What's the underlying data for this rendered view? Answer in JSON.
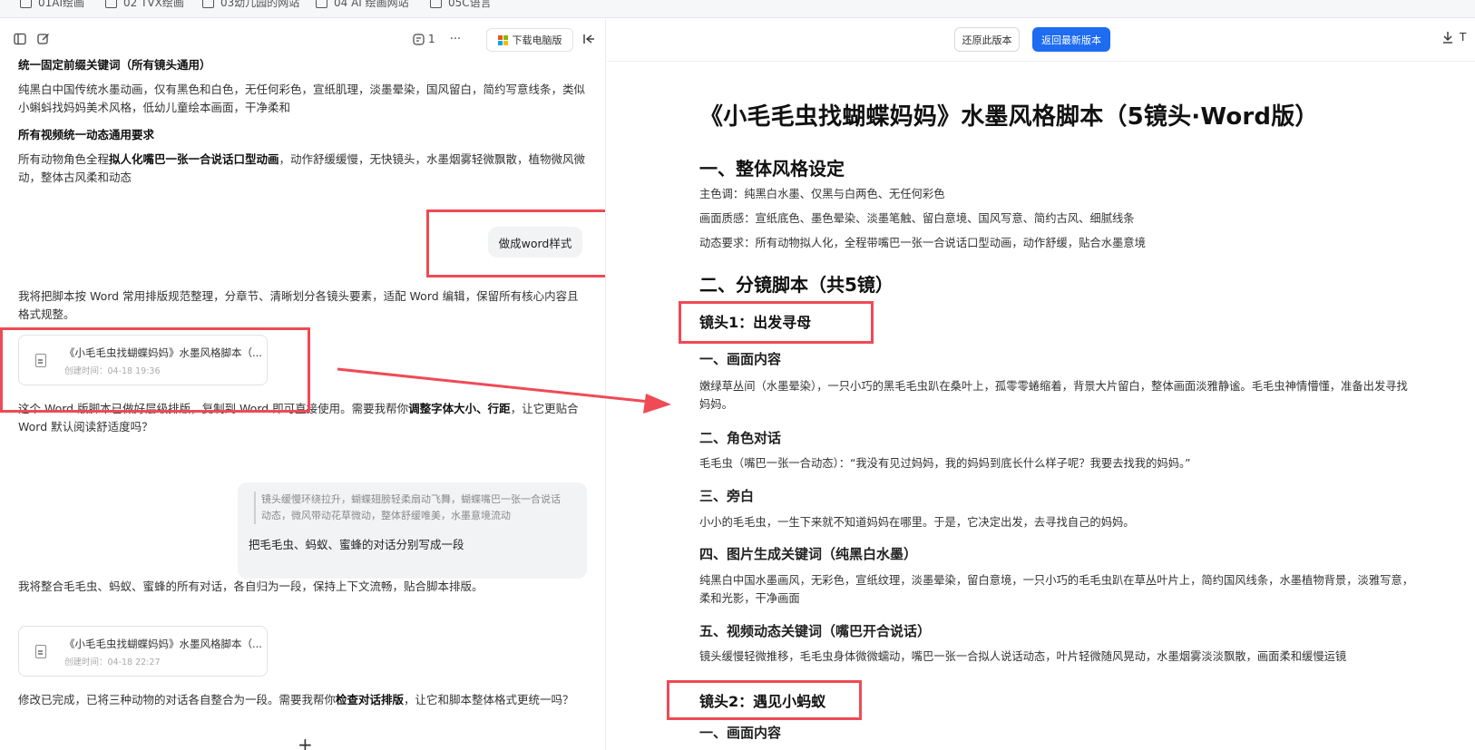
{
  "bookmarks": [
    "01AI绘画",
    "02 TVX绘画",
    "03幼儿园的网站",
    "04 AI 绘画网站",
    "05C语言"
  ],
  "left": {
    "toolbar": {
      "panel_icon": "sidebar-toggle-icon",
      "edit_icon": "edit-icon",
      "count": "1",
      "more": "···",
      "download_label": "下载电脑版",
      "collapse_icon": "collapse-icon"
    },
    "heading1": "统一固定前缀关键词（所有镜头通用）",
    "para1": "纯黑白中国传统水墨动画，仅有黑色和白色，无任何彩色，宣纸肌理，淡墨晕染，国风留白，简约写意线条，类似小蝌蚪找妈妈美术风格，低幼儿童绘本画面，干净柔和",
    "heading2": "所有视频统一动态通用要求",
    "para2_a": "所有动物角色全程",
    "para2_bold": "拟人化嘴巴一张一合说话口型动画",
    "para2_b": "，动作舒缓缓慢，无快镜头，水墨烟雾轻微飘散，植物微风微动，整体古风柔和动态",
    "user_msg1": "做成word样式",
    "para3": "我将把脚本按 Word 常用排版规范整理，分章节、清晰划分各镜头要素，适配 Word 编辑，保留所有核心内容且格式规整。",
    "card1": {
      "title": "《小毛毛虫找蝴蝶妈妈》水墨风格脚本（...",
      "date": "创建时间：04-18 19:36"
    },
    "para4_a": "这个 Word 版脚本已做好层级排版，复制到 Word 即可直接使用。需要我帮你",
    "para4_bold": "调整字体大小、行距",
    "para4_b": "，让它更贴合 Word 默认阅读舒适度吗？",
    "quote_text": "镜头缓慢环绕拉升，蝴蝶翅膀轻柔扇动飞舞，蝴蝶嘴巴一张一合说话动态，微风带动花草微动，整体舒缓唯美，水墨意境流动",
    "user_msg2": "把毛毛虫、蚂蚁、蜜蜂的对话分别写成一段",
    "para5": "我将整合毛毛虫、蚂蚁、蜜蜂的所有对话，各自归为一段，保持上下文流畅，贴合脚本排版。",
    "card2": {
      "title": "《小毛毛虫找蝴蝶妈妈》水墨风格脚本（...",
      "date": "创建时间：04-18 22:27"
    },
    "para6_a": "修改已完成，已将三种动物的对话各自整合为一段。需要我帮你",
    "para6_bold": "检查对话排版",
    "para6_b": "，让它和脚本整体格式更统一吗？",
    "plus": "+"
  },
  "right": {
    "restore_label": "还原此版本",
    "latest_label": "返回最新版本",
    "download_t": "T",
    "doc": {
      "title": "《小毛毛虫找蝴蝶妈妈》水墨风格脚本（5镜头·Word版）",
      "sec1": "一、整体风格设定",
      "style1": "主色调：纯黑白水墨、仅黑与白两色、无任何彩色",
      "style2": "画面质感：宣纸底色、墨色晕染、淡墨笔触、留白意境、国风写意、简约古风、细腻线条",
      "style3": "动态要求：所有动物拟人化，全程带嘴巴一张一合说话口型动画，动作舒缓，贴合水墨意境",
      "sec2": "二、分镜脚本（共5镜）",
      "shot1": "镜头1：出发寻母",
      "s1_h1": "一、画面内容",
      "s1_p1": "嫩绿草丛间（水墨晕染），一只小巧的黑毛毛虫趴在桑叶上，孤零零蜷缩着，背景大片留白，整体画面淡雅静谧。毛毛虫神情懵懂，准备出发寻找妈妈。",
      "s1_h2": "二、角色对话",
      "s1_p2": "毛毛虫（嘴巴一张一合动态）：“我没有见过妈妈，我的妈妈到底长什么样子呢？我要去找我的妈妈。”",
      "s1_h3": "三、旁白",
      "s1_p3": "小小的毛毛虫，一生下来就不知道妈妈在哪里。于是，它决定出发，去寻找自己的妈妈。",
      "s1_h4": "四、图片生成关键词（纯黑白水墨）",
      "s1_p4": "纯黑白中国水墨画风，无彩色，宣纸纹理，淡墨晕染，留白意境，一只小巧的毛毛虫趴在草丛叶片上，简约国风线条，水墨植物背景，淡雅写意，柔和光影，干净画面",
      "s1_h5": "五、视频动态关键词（嘴巴开合说话）",
      "s1_p5": "镜头缓慢轻微推移，毛毛虫身体微微蠕动，嘴巴一张一合拟人说话动态，叶片轻微随风晃动，水墨烟雾淡淡飘散，画面柔和缓慢运镜",
      "shot2": "镜头2：遇见小蚂蚁",
      "s2_h1": "一、画面内容"
    }
  },
  "colors": {
    "accent": "#1d6cf2",
    "highlight_box": "#ef4a55",
    "arrow": "#ef4a55"
  }
}
